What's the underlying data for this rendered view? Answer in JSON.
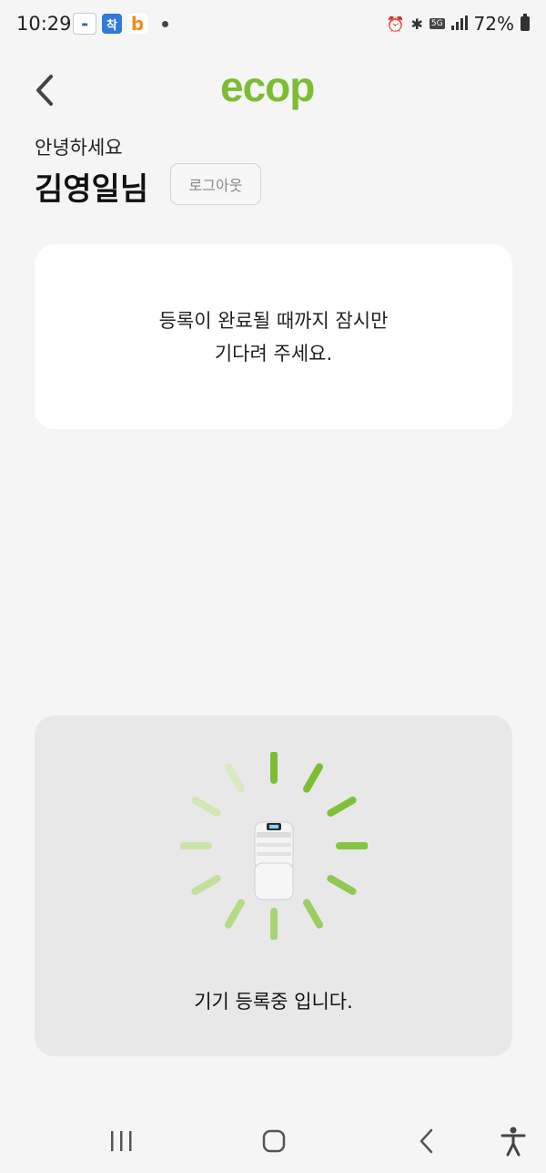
{
  "status_bar": {
    "time": "10:29",
    "battery_text": "72%",
    "network_badge": "5G",
    "apps": [
      {
        "name": "notification-app-1",
        "label": "shinhan"
      },
      {
        "name": "notification-app-2",
        "label": "착"
      },
      {
        "name": "notification-app-3",
        "label": "b"
      }
    ]
  },
  "header": {
    "logo_text": "ecop",
    "brand_color": "#7cbd34"
  },
  "user": {
    "greeting": "안녕하세요",
    "name": "김영일님",
    "logout_label": "로그아웃"
  },
  "message_card": {
    "line1": "등록이 완료될 때까지 잠시만",
    "line2": "기다려 주세요."
  },
  "register_panel": {
    "status_text": "기기 등록중 입니다.",
    "device_icon": "air-purifier-device"
  },
  "nav": {
    "recent_icon": "recent-apps-icon",
    "home_icon": "home-icon",
    "back_icon": "back-icon",
    "accessibility_icon": "accessibility-icon"
  }
}
